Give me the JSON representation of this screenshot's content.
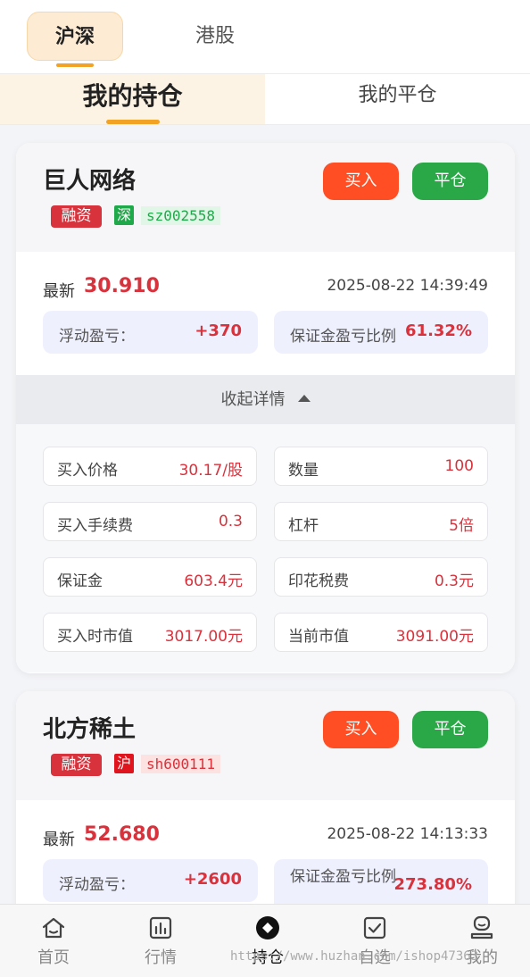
{
  "market_tabs": [
    {
      "label": "沪深",
      "active": true
    },
    {
      "label": "港股",
      "active": false
    }
  ],
  "position_tabs": [
    {
      "label": "我的持仓",
      "active": true
    },
    {
      "label": "我的平仓",
      "active": false
    }
  ],
  "colors": {
    "accent": "#f2a225",
    "buy": "#ff4d24",
    "close": "#2aa847",
    "up": "#d8323c",
    "sz_tag": "#20a94a",
    "sh_tag": "#e0141d"
  },
  "positions": [
    {
      "name": "巨人网络",
      "tag": "融资",
      "exchange": "深",
      "code": "sz002558",
      "buy_label": "买入",
      "close_label": "平仓",
      "latest_label": "最新",
      "latest": "30.910",
      "time": "2025-08-22 14:39:49",
      "float_pl_label": "浮动盈亏：",
      "float_pl": "+370",
      "margin_ratio_label": "保证金盈亏比例",
      "margin_ratio": "61.32%",
      "collapse_label": "收起详情",
      "details": [
        {
          "label": "买入价格",
          "value": "30.17/股"
        },
        {
          "label": "数量",
          "value": "100"
        },
        {
          "label": "买入手续费",
          "value": "0.3"
        },
        {
          "label": "杠杆",
          "value": "5倍"
        },
        {
          "label": "保证金",
          "value": "603.4元"
        },
        {
          "label": "印花税费",
          "value": "0.3元"
        },
        {
          "label": "买入时市值",
          "value": "3017.00元"
        },
        {
          "label": "当前市值",
          "value": "3091.00元"
        }
      ]
    },
    {
      "name": "北方稀土",
      "tag": "融资",
      "exchange": "沪",
      "code": "sh600111",
      "buy_label": "买入",
      "close_label": "平仓",
      "latest_label": "最新",
      "latest": "52.680",
      "time": "2025-08-22 14:13:33",
      "float_pl_label": "浮动盈亏：",
      "float_pl": "+2600",
      "margin_ratio_label": "保证金盈亏比例",
      "margin_ratio": "273.80%"
    }
  ],
  "bottom_nav": [
    {
      "label": "首页",
      "icon": "home-icon"
    },
    {
      "label": "行情",
      "icon": "chart-icon"
    },
    {
      "label": "持仓",
      "icon": "holdings-icon",
      "active": true
    },
    {
      "label": "自选",
      "icon": "checkbox-icon"
    },
    {
      "label": "我的",
      "icon": "profile-icon"
    }
  ],
  "watermark": "https://www.huzhan.com/ishop47363"
}
